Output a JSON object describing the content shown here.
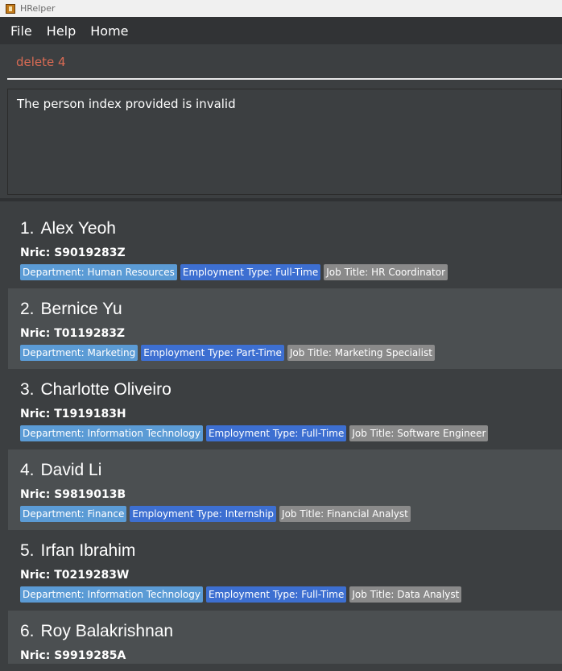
{
  "window": {
    "title": "HRelper"
  },
  "menu": {
    "file": "File",
    "help": "Help",
    "home": "Home"
  },
  "command": {
    "value": "delete 4"
  },
  "result": {
    "message": "The person index provided is invalid"
  },
  "persons": [
    {
      "index": "1.",
      "name": "Alex Yeoh",
      "nric": "Nric: S9019283Z",
      "department": "Department: Human Resources",
      "employment": "Employment Type: Full-Time",
      "job": "Job Title: HR Coordinator"
    },
    {
      "index": "2.",
      "name": "Bernice Yu",
      "nric": "Nric: T0119283Z",
      "department": "Department: Marketing",
      "employment": "Employment Type: Part-Time",
      "job": "Job Title: Marketing Specialist"
    },
    {
      "index": "3.",
      "name": "Charlotte Oliveiro",
      "nric": "Nric: T1919183H",
      "department": "Department: Information Technology",
      "employment": "Employment Type: Full-Time",
      "job": "Job Title: Software Engineer"
    },
    {
      "index": "4.",
      "name": "David Li",
      "nric": "Nric: S9819013B",
      "department": "Department: Finance",
      "employment": "Employment Type: Internship",
      "job": "Job Title: Financial Analyst"
    },
    {
      "index": "5.",
      "name": "Irfan Ibrahim",
      "nric": "Nric: T0219283W",
      "department": "Department: Information Technology",
      "employment": "Employment Type: Full-Time",
      "job": "Job Title: Data Analyst"
    },
    {
      "index": "6.",
      "name": "Roy Balakrishnan",
      "nric": "Nric: S9919285A"
    }
  ]
}
